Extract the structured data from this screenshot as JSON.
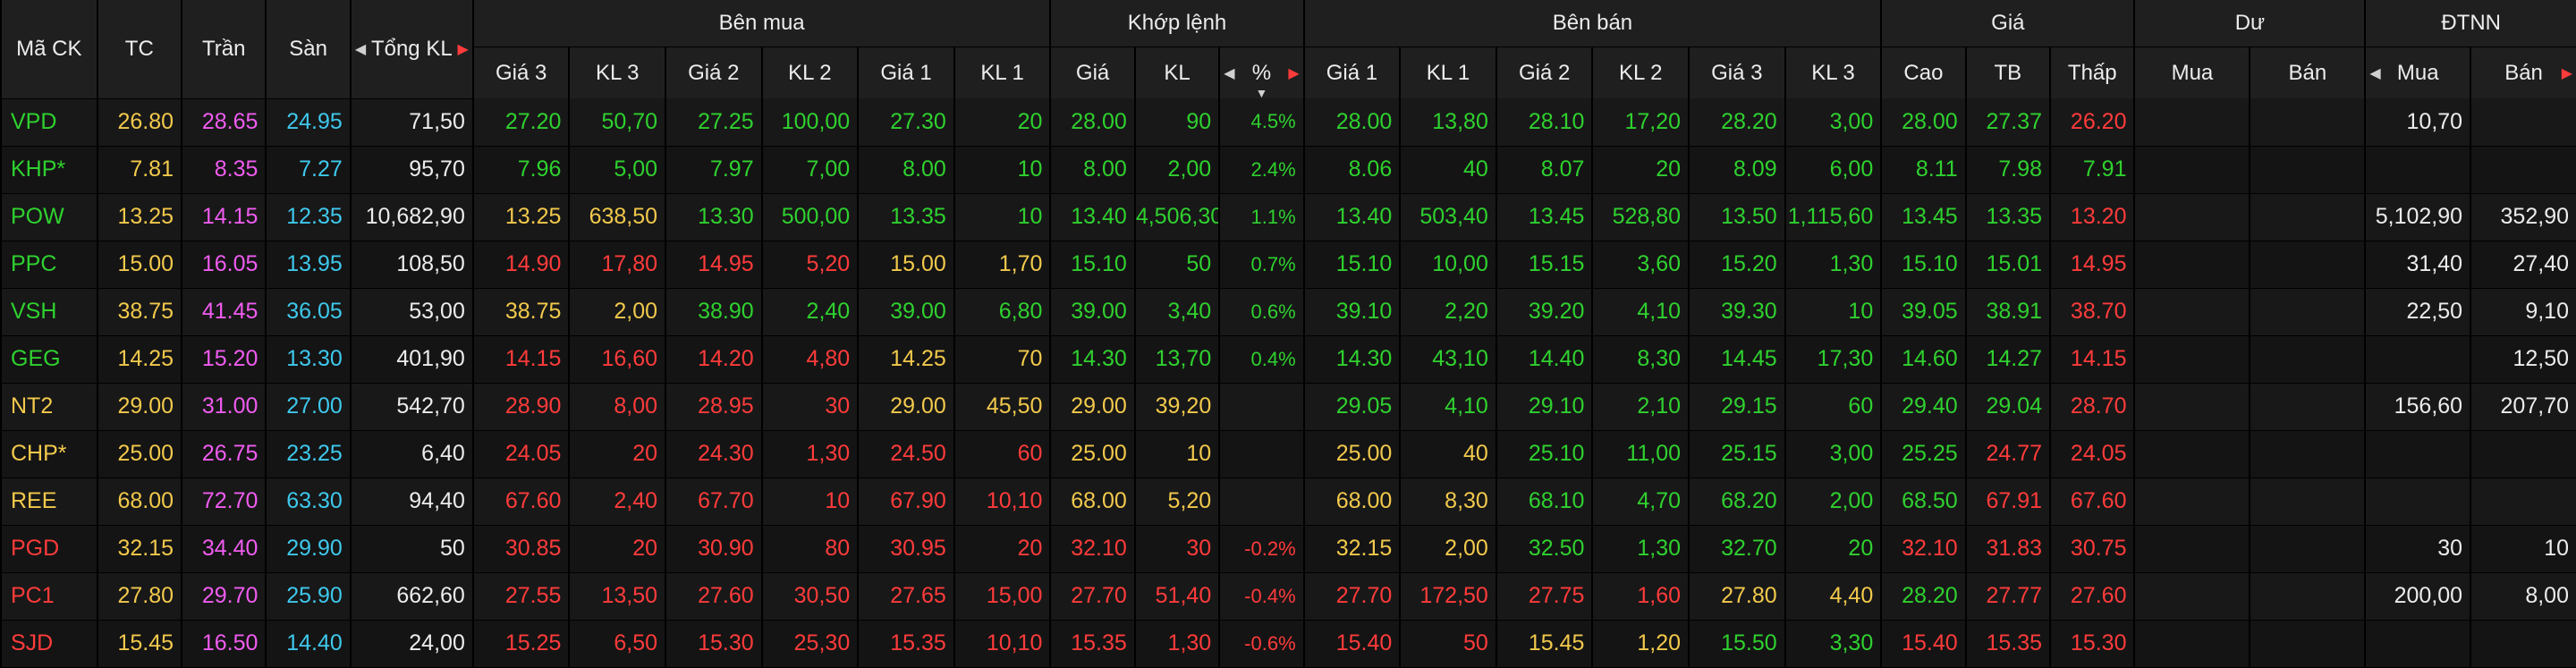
{
  "headers": {
    "symbol": "Mã CK",
    "ref": "TC",
    "ceil": "Trần",
    "floor": "Sàn",
    "total_vol": "Tổng KL",
    "buy_group": "Bên mua",
    "match_group": "Khớp lệnh",
    "sell_group": "Bên bán",
    "price_group": "Giá",
    "remain_group": "Dư",
    "foreign_group": "ĐTNN",
    "buy_cols": [
      "Giá 3",
      "KL 3",
      "Giá 2",
      "KL 2",
      "Giá 1",
      "KL 1"
    ],
    "match_cols": [
      "Giá",
      "KL",
      "%"
    ],
    "sell_cols": [
      "Giá 1",
      "KL 1",
      "Giá 2",
      "KL 2",
      "Giá 3",
      "KL 3"
    ],
    "price_cols": [
      "Cao",
      "TB",
      "Thấp"
    ],
    "remain_cols": [
      "Mua",
      "Bán"
    ],
    "foreign_cols": [
      "Mua",
      "Bán"
    ]
  },
  "colors": {
    "up": "#2fd12f",
    "ref": "#f2c94c",
    "down": "#ff3b3b",
    "ceiling": "#f05cf0",
    "floor": "#3ec8ec",
    "neutral": "#ececec",
    "header_bg": "#1f1f1f",
    "row_bg": "#181818"
  },
  "rows": [
    {
      "sym": [
        "VPD",
        "g"
      ],
      "tc": [
        "26.80",
        "y"
      ],
      "tran": [
        "28.65",
        "p"
      ],
      "san": [
        "24.95",
        "c"
      ],
      "kl": [
        "71,50",
        "w"
      ],
      "b3p": [
        "27.20",
        "g"
      ],
      "b3v": [
        "50,70",
        "g"
      ],
      "b2p": [
        "27.25",
        "g"
      ],
      "b2v": [
        "100,00",
        "g"
      ],
      "b1p": [
        "27.30",
        "g"
      ],
      "b1v": [
        "20",
        "g"
      ],
      "mp": [
        "28.00",
        "g"
      ],
      "mv": [
        "90",
        "g"
      ],
      "pct": [
        "4.5%",
        "g"
      ],
      "s1p": [
        "28.00",
        "g"
      ],
      "s1v": [
        "13,80",
        "g"
      ],
      "s2p": [
        "28.10",
        "g"
      ],
      "s2v": [
        "17,20",
        "g"
      ],
      "s3p": [
        "28.20",
        "g"
      ],
      "s3v": [
        "3,00",
        "g"
      ],
      "hi": [
        "28.00",
        "g"
      ],
      "avg": [
        "27.37",
        "g"
      ],
      "lo": [
        "26.20",
        "r"
      ],
      "rb": [
        "",
        "w"
      ],
      "rs": [
        "",
        "w"
      ],
      "fb": [
        "10,70",
        "w"
      ],
      "fs": [
        "",
        "w"
      ]
    },
    {
      "sym": [
        "KHP*",
        "g"
      ],
      "tc": [
        "7.81",
        "y"
      ],
      "tran": [
        "8.35",
        "p"
      ],
      "san": [
        "7.27",
        "c"
      ],
      "kl": [
        "95,70",
        "w"
      ],
      "b3p": [
        "7.96",
        "g"
      ],
      "b3v": [
        "5,00",
        "g"
      ],
      "b2p": [
        "7.97",
        "g"
      ],
      "b2v": [
        "7,00",
        "g"
      ],
      "b1p": [
        "8.00",
        "g"
      ],
      "b1v": [
        "10",
        "g"
      ],
      "mp": [
        "8.00",
        "g"
      ],
      "mv": [
        "2,00",
        "g"
      ],
      "pct": [
        "2.4%",
        "g"
      ],
      "s1p": [
        "8.06",
        "g"
      ],
      "s1v": [
        "40",
        "g"
      ],
      "s2p": [
        "8.07",
        "g"
      ],
      "s2v": [
        "20",
        "g"
      ],
      "s3p": [
        "8.09",
        "g"
      ],
      "s3v": [
        "6,00",
        "g"
      ],
      "hi": [
        "8.11",
        "g"
      ],
      "avg": [
        "7.98",
        "g"
      ],
      "lo": [
        "7.91",
        "g"
      ],
      "rb": [
        "",
        "w"
      ],
      "rs": [
        "",
        "w"
      ],
      "fb": [
        "",
        "w"
      ],
      "fs": [
        "",
        "w"
      ]
    },
    {
      "sym": [
        "POW",
        "g"
      ],
      "tc": [
        "13.25",
        "y"
      ],
      "tran": [
        "14.15",
        "p"
      ],
      "san": [
        "12.35",
        "c"
      ],
      "kl": [
        "10,682,90",
        "w"
      ],
      "b3p": [
        "13.25",
        "y"
      ],
      "b3v": [
        "638,50",
        "y"
      ],
      "b2p": [
        "13.30",
        "g"
      ],
      "b2v": [
        "500,00",
        "g"
      ],
      "b1p": [
        "13.35",
        "g"
      ],
      "b1v": [
        "10",
        "g"
      ],
      "mp": [
        "13.40",
        "g"
      ],
      "mv": [
        "4,506,30",
        "g"
      ],
      "pct": [
        "1.1%",
        "g"
      ],
      "s1p": [
        "13.40",
        "g"
      ],
      "s1v": [
        "503,40",
        "g"
      ],
      "s2p": [
        "13.45",
        "g"
      ],
      "s2v": [
        "528,80",
        "g"
      ],
      "s3p": [
        "13.50",
        "g"
      ],
      "s3v": [
        "1,115,60",
        "g"
      ],
      "hi": [
        "13.45",
        "g"
      ],
      "avg": [
        "13.35",
        "g"
      ],
      "lo": [
        "13.20",
        "r"
      ],
      "rb": [
        "",
        "w"
      ],
      "rs": [
        "",
        "w"
      ],
      "fb": [
        "5,102,90",
        "w"
      ],
      "fs": [
        "352,90",
        "w"
      ]
    },
    {
      "sym": [
        "PPC",
        "g"
      ],
      "tc": [
        "15.00",
        "y"
      ],
      "tran": [
        "16.05",
        "p"
      ],
      "san": [
        "13.95",
        "c"
      ],
      "kl": [
        "108,50",
        "w"
      ],
      "b3p": [
        "14.90",
        "r"
      ],
      "b3v": [
        "17,80",
        "r"
      ],
      "b2p": [
        "14.95",
        "r"
      ],
      "b2v": [
        "5,20",
        "r"
      ],
      "b1p": [
        "15.00",
        "y"
      ],
      "b1v": [
        "1,70",
        "y"
      ],
      "mp": [
        "15.10",
        "g"
      ],
      "mv": [
        "50",
        "g"
      ],
      "pct": [
        "0.7%",
        "g"
      ],
      "s1p": [
        "15.10",
        "g"
      ],
      "s1v": [
        "10,00",
        "g"
      ],
      "s2p": [
        "15.15",
        "g"
      ],
      "s2v": [
        "3,60",
        "g"
      ],
      "s3p": [
        "15.20",
        "g"
      ],
      "s3v": [
        "1,30",
        "g"
      ],
      "hi": [
        "15.10",
        "g"
      ],
      "avg": [
        "15.01",
        "g"
      ],
      "lo": [
        "14.95",
        "r"
      ],
      "rb": [
        "",
        "w"
      ],
      "rs": [
        "",
        "w"
      ],
      "fb": [
        "31,40",
        "w"
      ],
      "fs": [
        "27,40",
        "w"
      ]
    },
    {
      "sym": [
        "VSH",
        "g"
      ],
      "tc": [
        "38.75",
        "y"
      ],
      "tran": [
        "41.45",
        "p"
      ],
      "san": [
        "36.05",
        "c"
      ],
      "kl": [
        "53,00",
        "w"
      ],
      "b3p": [
        "38.75",
        "y"
      ],
      "b3v": [
        "2,00",
        "y"
      ],
      "b2p": [
        "38.90",
        "g"
      ],
      "b2v": [
        "2,40",
        "g"
      ],
      "b1p": [
        "39.00",
        "g"
      ],
      "b1v": [
        "6,80",
        "g"
      ],
      "mp": [
        "39.00",
        "g"
      ],
      "mv": [
        "3,40",
        "g"
      ],
      "pct": [
        "0.6%",
        "g"
      ],
      "s1p": [
        "39.10",
        "g"
      ],
      "s1v": [
        "2,20",
        "g"
      ],
      "s2p": [
        "39.20",
        "g"
      ],
      "s2v": [
        "4,10",
        "g"
      ],
      "s3p": [
        "39.30",
        "g"
      ],
      "s3v": [
        "10",
        "g"
      ],
      "hi": [
        "39.05",
        "g"
      ],
      "avg": [
        "38.91",
        "g"
      ],
      "lo": [
        "38.70",
        "r"
      ],
      "rb": [
        "",
        "w"
      ],
      "rs": [
        "",
        "w"
      ],
      "fb": [
        "22,50",
        "w"
      ],
      "fs": [
        "9,10",
        "w"
      ]
    },
    {
      "sym": [
        "GEG",
        "g"
      ],
      "tc": [
        "14.25",
        "y"
      ],
      "tran": [
        "15.20",
        "p"
      ],
      "san": [
        "13.30",
        "c"
      ],
      "kl": [
        "401,90",
        "w"
      ],
      "b3p": [
        "14.15",
        "r"
      ],
      "b3v": [
        "16,60",
        "r"
      ],
      "b2p": [
        "14.20",
        "r"
      ],
      "b2v": [
        "4,80",
        "r"
      ],
      "b1p": [
        "14.25",
        "y"
      ],
      "b1v": [
        "70",
        "y"
      ],
      "mp": [
        "14.30",
        "g"
      ],
      "mv": [
        "13,70",
        "g"
      ],
      "pct": [
        "0.4%",
        "g"
      ],
      "s1p": [
        "14.30",
        "g"
      ],
      "s1v": [
        "43,10",
        "g"
      ],
      "s2p": [
        "14.40",
        "g"
      ],
      "s2v": [
        "8,30",
        "g"
      ],
      "s3p": [
        "14.45",
        "g"
      ],
      "s3v": [
        "17,30",
        "g"
      ],
      "hi": [
        "14.60",
        "g"
      ],
      "avg": [
        "14.27",
        "g"
      ],
      "lo": [
        "14.15",
        "r"
      ],
      "rb": [
        "",
        "w"
      ],
      "rs": [
        "",
        "w"
      ],
      "fb": [
        "",
        "w"
      ],
      "fs": [
        "12,50",
        "w"
      ]
    },
    {
      "sym": [
        "NT2",
        "y"
      ],
      "tc": [
        "29.00",
        "y"
      ],
      "tran": [
        "31.00",
        "p"
      ],
      "san": [
        "27.00",
        "c"
      ],
      "kl": [
        "542,70",
        "w"
      ],
      "b3p": [
        "28.90",
        "r"
      ],
      "b3v": [
        "8,00",
        "r"
      ],
      "b2p": [
        "28.95",
        "r"
      ],
      "b2v": [
        "30",
        "r"
      ],
      "b1p": [
        "29.00",
        "y"
      ],
      "b1v": [
        "45,50",
        "y"
      ],
      "mp": [
        "29.00",
        "y"
      ],
      "mv": [
        "39,20",
        "y"
      ],
      "pct": [
        "",
        "w"
      ],
      "s1p": [
        "29.05",
        "g"
      ],
      "s1v": [
        "4,10",
        "g"
      ],
      "s2p": [
        "29.10",
        "g"
      ],
      "s2v": [
        "2,10",
        "g"
      ],
      "s3p": [
        "29.15",
        "g"
      ],
      "s3v": [
        "60",
        "g"
      ],
      "hi": [
        "29.40",
        "g"
      ],
      "avg": [
        "29.04",
        "g"
      ],
      "lo": [
        "28.70",
        "r"
      ],
      "rb": [
        "",
        "w"
      ],
      "rs": [
        "",
        "w"
      ],
      "fb": [
        "156,60",
        "w"
      ],
      "fs": [
        "207,70",
        "w"
      ]
    },
    {
      "sym": [
        "CHP*",
        "y"
      ],
      "tc": [
        "25.00",
        "y"
      ],
      "tran": [
        "26.75",
        "p"
      ],
      "san": [
        "23.25",
        "c"
      ],
      "kl": [
        "6,40",
        "w"
      ],
      "b3p": [
        "24.05",
        "r"
      ],
      "b3v": [
        "20",
        "r"
      ],
      "b2p": [
        "24.30",
        "r"
      ],
      "b2v": [
        "1,30",
        "r"
      ],
      "b1p": [
        "24.50",
        "r"
      ],
      "b1v": [
        "60",
        "r"
      ],
      "mp": [
        "25.00",
        "y"
      ],
      "mv": [
        "10",
        "y"
      ],
      "pct": [
        "",
        "w"
      ],
      "s1p": [
        "25.00",
        "y"
      ],
      "s1v": [
        "40",
        "y"
      ],
      "s2p": [
        "25.10",
        "g"
      ],
      "s2v": [
        "11,00",
        "g"
      ],
      "s3p": [
        "25.15",
        "g"
      ],
      "s3v": [
        "3,00",
        "g"
      ],
      "hi": [
        "25.25",
        "g"
      ],
      "avg": [
        "24.77",
        "r"
      ],
      "lo": [
        "24.05",
        "r"
      ],
      "rb": [
        "",
        "w"
      ],
      "rs": [
        "",
        "w"
      ],
      "fb": [
        "",
        "w"
      ],
      "fs": [
        "",
        "w"
      ]
    },
    {
      "sym": [
        "REE",
        "y"
      ],
      "tc": [
        "68.00",
        "y"
      ],
      "tran": [
        "72.70",
        "p"
      ],
      "san": [
        "63.30",
        "c"
      ],
      "kl": [
        "94,40",
        "w"
      ],
      "b3p": [
        "67.60",
        "r"
      ],
      "b3v": [
        "2,40",
        "r"
      ],
      "b2p": [
        "67.70",
        "r"
      ],
      "b2v": [
        "10",
        "r"
      ],
      "b1p": [
        "67.90",
        "r"
      ],
      "b1v": [
        "10,10",
        "r"
      ],
      "mp": [
        "68.00",
        "y"
      ],
      "mv": [
        "5,20",
        "y"
      ],
      "pct": [
        "",
        "w"
      ],
      "s1p": [
        "68.00",
        "y"
      ],
      "s1v": [
        "8,30",
        "y"
      ],
      "s2p": [
        "68.10",
        "g"
      ],
      "s2v": [
        "4,70",
        "g"
      ],
      "s3p": [
        "68.20",
        "g"
      ],
      "s3v": [
        "2,00",
        "g"
      ],
      "hi": [
        "68.50",
        "g"
      ],
      "avg": [
        "67.91",
        "r"
      ],
      "lo": [
        "67.60",
        "r"
      ],
      "rb": [
        "",
        "w"
      ],
      "rs": [
        "",
        "w"
      ],
      "fb": [
        "",
        "w"
      ],
      "fs": [
        "",
        "w"
      ]
    },
    {
      "sym": [
        "PGD",
        "r"
      ],
      "tc": [
        "32.15",
        "y"
      ],
      "tran": [
        "34.40",
        "p"
      ],
      "san": [
        "29.90",
        "c"
      ],
      "kl": [
        "50",
        "w"
      ],
      "b3p": [
        "30.85",
        "r"
      ],
      "b3v": [
        "20",
        "r"
      ],
      "b2p": [
        "30.90",
        "r"
      ],
      "b2v": [
        "80",
        "r"
      ],
      "b1p": [
        "30.95",
        "r"
      ],
      "b1v": [
        "20",
        "r"
      ],
      "mp": [
        "32.10",
        "r"
      ],
      "mv": [
        "30",
        "r"
      ],
      "pct": [
        "-0.2%",
        "r"
      ],
      "s1p": [
        "32.15",
        "y"
      ],
      "s1v": [
        "2,00",
        "y"
      ],
      "s2p": [
        "32.50",
        "g"
      ],
      "s2v": [
        "1,30",
        "g"
      ],
      "s3p": [
        "32.70",
        "g"
      ],
      "s3v": [
        "20",
        "g"
      ],
      "hi": [
        "32.10",
        "r"
      ],
      "avg": [
        "31.83",
        "r"
      ],
      "lo": [
        "30.75",
        "r"
      ],
      "rb": [
        "",
        "w"
      ],
      "rs": [
        "",
        "w"
      ],
      "fb": [
        "30",
        "w"
      ],
      "fs": [
        "10",
        "w"
      ]
    },
    {
      "sym": [
        "PC1",
        "r"
      ],
      "tc": [
        "27.80",
        "y"
      ],
      "tran": [
        "29.70",
        "p"
      ],
      "san": [
        "25.90",
        "c"
      ],
      "kl": [
        "662,60",
        "w"
      ],
      "b3p": [
        "27.55",
        "r"
      ],
      "b3v": [
        "13,50",
        "r"
      ],
      "b2p": [
        "27.60",
        "r"
      ],
      "b2v": [
        "30,50",
        "r"
      ],
      "b1p": [
        "27.65",
        "r"
      ],
      "b1v": [
        "15,00",
        "r"
      ],
      "mp": [
        "27.70",
        "r"
      ],
      "mv": [
        "51,40",
        "r"
      ],
      "pct": [
        "-0.4%",
        "r"
      ],
      "s1p": [
        "27.70",
        "r"
      ],
      "s1v": [
        "172,50",
        "r"
      ],
      "s2p": [
        "27.75",
        "r"
      ],
      "s2v": [
        "1,60",
        "r"
      ],
      "s3p": [
        "27.80",
        "y"
      ],
      "s3v": [
        "4,40",
        "y"
      ],
      "hi": [
        "28.20",
        "g"
      ],
      "avg": [
        "27.77",
        "r"
      ],
      "lo": [
        "27.60",
        "r"
      ],
      "rb": [
        "",
        "w"
      ],
      "rs": [
        "",
        "w"
      ],
      "fb": [
        "200,00",
        "w"
      ],
      "fs": [
        "8,00",
        "w"
      ]
    },
    {
      "sym": [
        "SJD",
        "r"
      ],
      "tc": [
        "15.45",
        "y"
      ],
      "tran": [
        "16.50",
        "p"
      ],
      "san": [
        "14.40",
        "c"
      ],
      "kl": [
        "24,00",
        "w"
      ],
      "b3p": [
        "15.25",
        "r"
      ],
      "b3v": [
        "6,50",
        "r"
      ],
      "b2p": [
        "15.30",
        "r"
      ],
      "b2v": [
        "25,30",
        "r"
      ],
      "b1p": [
        "15.35",
        "r"
      ],
      "b1v": [
        "10,10",
        "r"
      ],
      "mp": [
        "15.35",
        "r"
      ],
      "mv": [
        "1,30",
        "r"
      ],
      "pct": [
        "-0.6%",
        "r"
      ],
      "s1p": [
        "15.40",
        "r"
      ],
      "s1v": [
        "50",
        "r"
      ],
      "s2p": [
        "15.45",
        "y"
      ],
      "s2v": [
        "1,20",
        "y"
      ],
      "s3p": [
        "15.50",
        "g"
      ],
      "s3v": [
        "3,30",
        "g"
      ],
      "hi": [
        "15.40",
        "r"
      ],
      "avg": [
        "15.35",
        "r"
      ],
      "lo": [
        "15.30",
        "r"
      ],
      "rb": [
        "",
        "w"
      ],
      "rs": [
        "",
        "w"
      ],
      "fb": [
        "",
        "w"
      ],
      "fs": [
        "",
        "w"
      ]
    }
  ]
}
